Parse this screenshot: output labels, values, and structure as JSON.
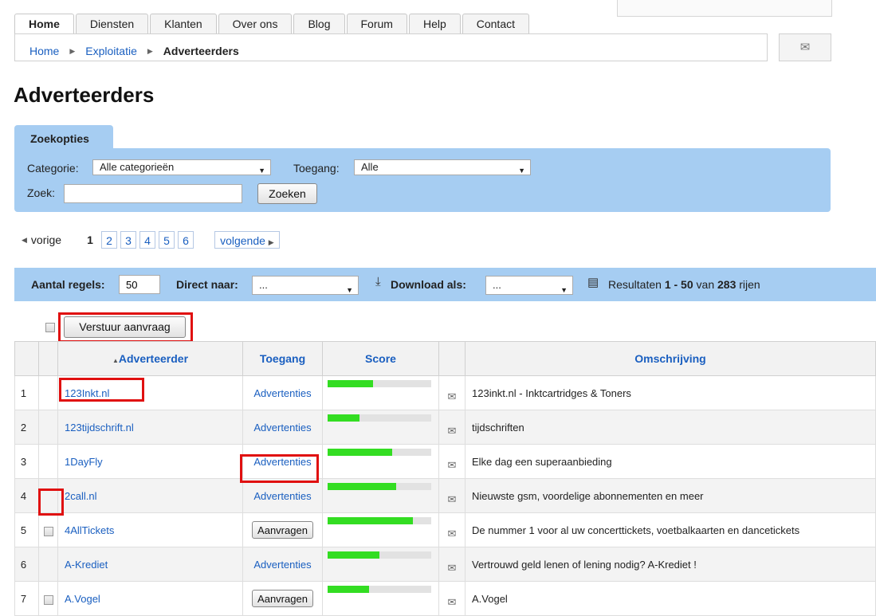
{
  "nav": {
    "tabs": [
      "Home",
      "Diensten",
      "Klanten",
      "Over ons",
      "Blog",
      "Forum",
      "Help",
      "Contact"
    ],
    "active_tab": "Home"
  },
  "breadcrumb": [
    "Home",
    "Exploitatie",
    "Adverteerders"
  ],
  "page_title": "Adverteerders",
  "search": {
    "tab_label": "Zoekopties",
    "category_label": "Categorie:",
    "category_value": "Alle categorieën",
    "access_label": "Toegang:",
    "access_value": "Alle",
    "query_label": "Zoek:",
    "query_value": "",
    "submit_label": "Zoeken"
  },
  "pagination": {
    "prev_label": "vorige",
    "pages": [
      "1",
      "2",
      "3",
      "4",
      "5",
      "6"
    ],
    "current_page": "1",
    "next_label": "volgende"
  },
  "toolbar": {
    "rows_label": "Aantal regels:",
    "rows_value": "50",
    "jump_label": "Direct naar:",
    "jump_value": "...",
    "download_label": "Download als:",
    "download_value": "...",
    "results_prefix": "Resultaten",
    "results_range": "1 - 50",
    "results_of": "van",
    "results_total": "283",
    "results_suffix": "rijen"
  },
  "send_request_label": "Verstuur aanvraag",
  "table": {
    "columns": [
      "Adverteerder",
      "Toegang",
      "Score",
      "",
      "Omschrijving"
    ],
    "sort_column": "Adverteerder",
    "rows": [
      {
        "num": "1",
        "advertiser": "123Inkt.nl",
        "access": "Advertenties",
        "score": 0.44,
        "description": "123inkt.nl - Inktcartridges & Toners"
      },
      {
        "num": "2",
        "advertiser": "123tijdschrift.nl",
        "access": "Advertenties",
        "score": 0.31,
        "description": "tijdschriften"
      },
      {
        "num": "3",
        "advertiser": "1DayFly",
        "access": "Advertenties",
        "score": 0.62,
        "description": "Elke dag een superaanbieding"
      },
      {
        "num": "4",
        "advertiser": "2call.nl",
        "access": "Advertenties",
        "score": 0.66,
        "description": "Nieuwste gsm, voordelige abonnementen en meer"
      },
      {
        "num": "5",
        "advertiser": "4AllTickets",
        "access": "Aanvragen",
        "score": 0.82,
        "description": "De nummer 1 voor al uw concerttickets, voetbalkaarten en dancetickets"
      },
      {
        "num": "6",
        "advertiser": "A-Krediet",
        "access": "Advertenties",
        "score": 0.5,
        "description": "Vertrouwd geld lenen of lening nodig? A-Krediet !"
      },
      {
        "num": "7",
        "advertiser": "A.Vogel",
        "access": "Aanvragen",
        "score": 0.4,
        "description": "A.Vogel"
      }
    ]
  },
  "colors": {
    "panel_blue": "#a6cdf2",
    "link_blue": "#1a5fc0",
    "score_green": "#33dd22",
    "highlight_red": "#e01010"
  }
}
